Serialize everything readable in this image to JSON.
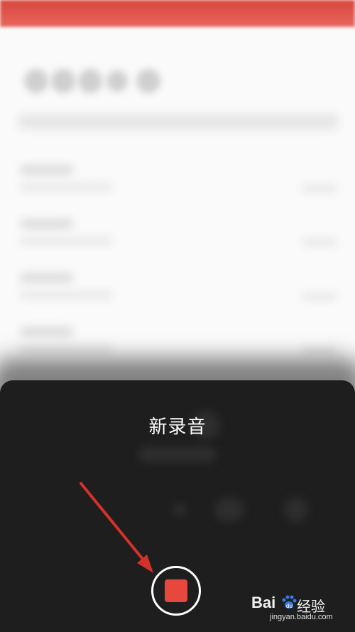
{
  "sheet": {
    "title": "新录音",
    "record_button": {
      "state": "recording",
      "stop_color": "#e7473c"
    }
  },
  "annotation": {
    "arrow_color": "#d3312a"
  },
  "watermark": {
    "brand": "Bai",
    "brand_suffix": "经验",
    "domain": "jingyan.baidu.com"
  }
}
